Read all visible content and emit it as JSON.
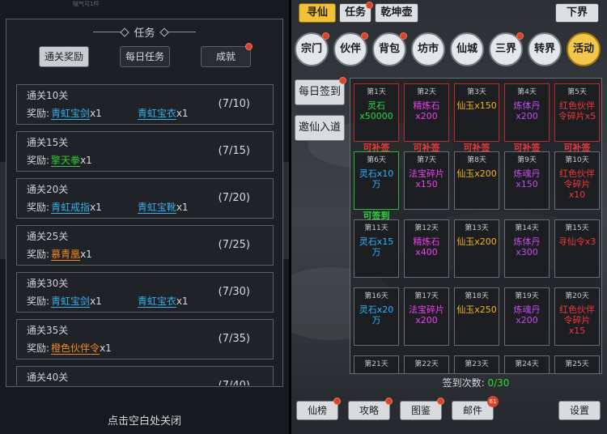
{
  "quest_dialog": {
    "title": "任务",
    "top_strip_text": "赋气可1怦",
    "tabs": [
      {
        "label": "通关奖励",
        "active": true
      },
      {
        "label": "每日任务",
        "active": false
      },
      {
        "label": "成就",
        "active": false
      }
    ],
    "reward_prefix": "奖励:",
    "quests": [
      {
        "title": "通关10关",
        "progress": "(7/10)",
        "rewards": [
          {
            "name": "青虹宝剑",
            "qty": "x1",
            "color": "blue"
          },
          {
            "name": "青虹宝衣",
            "qty": "x1",
            "color": "blue"
          }
        ]
      },
      {
        "title": "通关15关",
        "progress": "(7/15)",
        "rewards": [
          {
            "name": "擎天拳",
            "qty": "x1",
            "color": "green"
          }
        ]
      },
      {
        "title": "通关20关",
        "progress": "(7/20)",
        "rewards": [
          {
            "name": "青虹戒指",
            "qty": "x1",
            "color": "blue"
          },
          {
            "name": "青虹宝靴",
            "qty": "x1",
            "color": "blue"
          }
        ]
      },
      {
        "title": "通关25关",
        "progress": "(7/25)",
        "rewards": [
          {
            "name": "慕青凰",
            "qty": "x1",
            "color": "orange"
          }
        ]
      },
      {
        "title": "通关30关",
        "progress": "(7/30)",
        "rewards": [
          {
            "name": "青虹宝剑",
            "qty": "x1",
            "color": "blue"
          },
          {
            "name": "青虹宝衣",
            "qty": "x1",
            "color": "blue"
          }
        ]
      },
      {
        "title": "通关35关",
        "progress": "(7/35)",
        "rewards": [
          {
            "name": "橙色伙伴令",
            "qty": "x1",
            "color": "orange"
          }
        ]
      },
      {
        "title": "通关40关",
        "progress": "(7/40)",
        "rewards": []
      }
    ],
    "close_hint": "点击空白处关闭"
  },
  "right_panel": {
    "top_tabs": [
      {
        "label": "寻仙",
        "active": true,
        "dot": false
      },
      {
        "label": "任务",
        "active": false,
        "dot": true
      },
      {
        "label": "乾坤壶",
        "active": false,
        "dot": false
      }
    ],
    "realm_button": "下界",
    "circles": [
      {
        "label": "宗门",
        "dot": true,
        "active": false
      },
      {
        "label": "伙伴",
        "dot": true,
        "active": false
      },
      {
        "label": "背包",
        "dot": true,
        "active": false
      },
      {
        "label": "坊市",
        "dot": false,
        "active": false
      },
      {
        "label": "仙城",
        "dot": false,
        "active": false
      },
      {
        "label": "三界",
        "dot": true,
        "active": false
      },
      {
        "label": "转界",
        "dot": false,
        "active": false
      },
      {
        "label": "活动",
        "dot": false,
        "active": true
      }
    ],
    "side_buttons": [
      {
        "label": "每日签到",
        "dot": true
      },
      {
        "label": "邀仙入道",
        "dot": false
      }
    ],
    "signin_days": [
      {
        "day": "第1天",
        "reward": "灵石\nx50000",
        "color": "green",
        "border": "red",
        "status": "可补签",
        "status_color": "red"
      },
      {
        "day": "第2天",
        "reward": "精炼石\nx200",
        "color": "pink",
        "border": "red",
        "status": "可补签",
        "status_color": "red"
      },
      {
        "day": "第3天",
        "reward": "仙玉x150",
        "color": "orange",
        "border": "red",
        "status": "可补签",
        "status_color": "red"
      },
      {
        "day": "第4天",
        "reward": "炼体丹\nx200",
        "color": "purple",
        "border": "red",
        "status": "可补签",
        "status_color": "red"
      },
      {
        "day": "第5天",
        "reward": "红色伙伴\n令碎片x5",
        "color": "red",
        "border": "red",
        "status": "可补签",
        "status_color": "red"
      },
      {
        "day": "第6天",
        "reward": "灵石x10\n万",
        "color": "blue",
        "border": "green",
        "status": "可签到",
        "status_color": "green"
      },
      {
        "day": "第7天",
        "reward": "法宝碎片\nx150",
        "color": "pink",
        "border": "gray",
        "status": "",
        "status_color": ""
      },
      {
        "day": "第8天",
        "reward": "仙玉x200",
        "color": "orange",
        "border": "gray",
        "status": "",
        "status_color": ""
      },
      {
        "day": "第9天",
        "reward": "炼魂丹\nx150",
        "color": "purple",
        "border": "gray",
        "status": "",
        "status_color": ""
      },
      {
        "day": "第10天",
        "reward": "红色伙伴\n令碎片\nx10",
        "color": "red",
        "border": "gray",
        "status": "",
        "status_color": ""
      },
      {
        "day": "第11天",
        "reward": "灵石x15\n万",
        "color": "blue",
        "border": "gray",
        "status": "",
        "status_color": ""
      },
      {
        "day": "第12天",
        "reward": "精炼石\nx400",
        "color": "pink",
        "border": "gray",
        "status": "",
        "status_color": ""
      },
      {
        "day": "第13天",
        "reward": "仙玉x200",
        "color": "orange",
        "border": "gray",
        "status": "",
        "status_color": ""
      },
      {
        "day": "第14天",
        "reward": "炼体丹\nx300",
        "color": "purple",
        "border": "gray",
        "status": "",
        "status_color": ""
      },
      {
        "day": "第15天",
        "reward": "寻仙令x3",
        "color": "red",
        "border": "gray",
        "status": "",
        "status_color": ""
      },
      {
        "day": "第16天",
        "reward": "灵石x20\n万",
        "color": "blue",
        "border": "gray",
        "status": "",
        "status_color": ""
      },
      {
        "day": "第17天",
        "reward": "法宝碎片\nx200",
        "color": "pink",
        "border": "gray",
        "status": "",
        "status_color": ""
      },
      {
        "day": "第18天",
        "reward": "仙玉x250",
        "color": "orange",
        "border": "gray",
        "status": "",
        "status_color": ""
      },
      {
        "day": "第19天",
        "reward": "炼魂丹\nx200",
        "color": "purple",
        "border": "gray",
        "status": "",
        "status_color": ""
      },
      {
        "day": "第20天",
        "reward": "红色伙伴\n令碎片\nx15",
        "color": "red",
        "border": "gray",
        "status": "",
        "status_color": ""
      },
      {
        "day": "第21天",
        "reward": "",
        "color": "",
        "border": "gray",
        "status": "",
        "status_color": ""
      },
      {
        "day": "第22天",
        "reward": "",
        "color": "",
        "border": "gray",
        "status": "",
        "status_color": ""
      },
      {
        "day": "第23天",
        "reward": "",
        "color": "",
        "border": "gray",
        "status": "",
        "status_color": ""
      },
      {
        "day": "第24天",
        "reward": "",
        "color": "",
        "border": "gray",
        "status": "",
        "status_color": ""
      },
      {
        "day": "第25天",
        "reward": "",
        "color": "",
        "border": "gray",
        "status": "",
        "status_color": ""
      }
    ],
    "sign_count_label": "签到次数:",
    "sign_count_value": "0/30",
    "bottom_buttons": [
      {
        "label": "仙榜",
        "dot": true
      },
      {
        "label": "攻略",
        "dot": true
      },
      {
        "label": "图鉴",
        "dot": true
      },
      {
        "label": "邮件",
        "dot": true,
        "count": "61"
      },
      {
        "label": "设置",
        "dot": false
      }
    ]
  }
}
